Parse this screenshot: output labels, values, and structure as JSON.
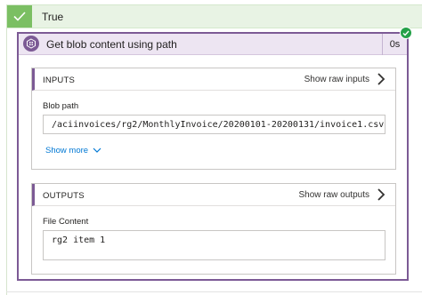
{
  "condition": {
    "label": "True",
    "icon": "checkmark-icon",
    "color": "#7bbf63"
  },
  "action": {
    "title": "Get blob content using path",
    "duration": "0s",
    "icon": "blob-storage-icon",
    "accent_color": "#7c5a95",
    "status": "succeeded",
    "status_color": "#24a148"
  },
  "inputs": {
    "title": "INPUTS",
    "show_raw_label": "Show raw inputs",
    "blob_path_label": "Blob path",
    "blob_path_value": "/aciinvoices/rg2/MonthlyInvoice/20200101-20200131/invoice1.csv",
    "show_more_label": "Show more"
  },
  "outputs": {
    "title": "OUTPUTS",
    "show_raw_label": "Show raw outputs",
    "file_content_label": "File Content",
    "file_content_value": "rg2 item 1"
  }
}
